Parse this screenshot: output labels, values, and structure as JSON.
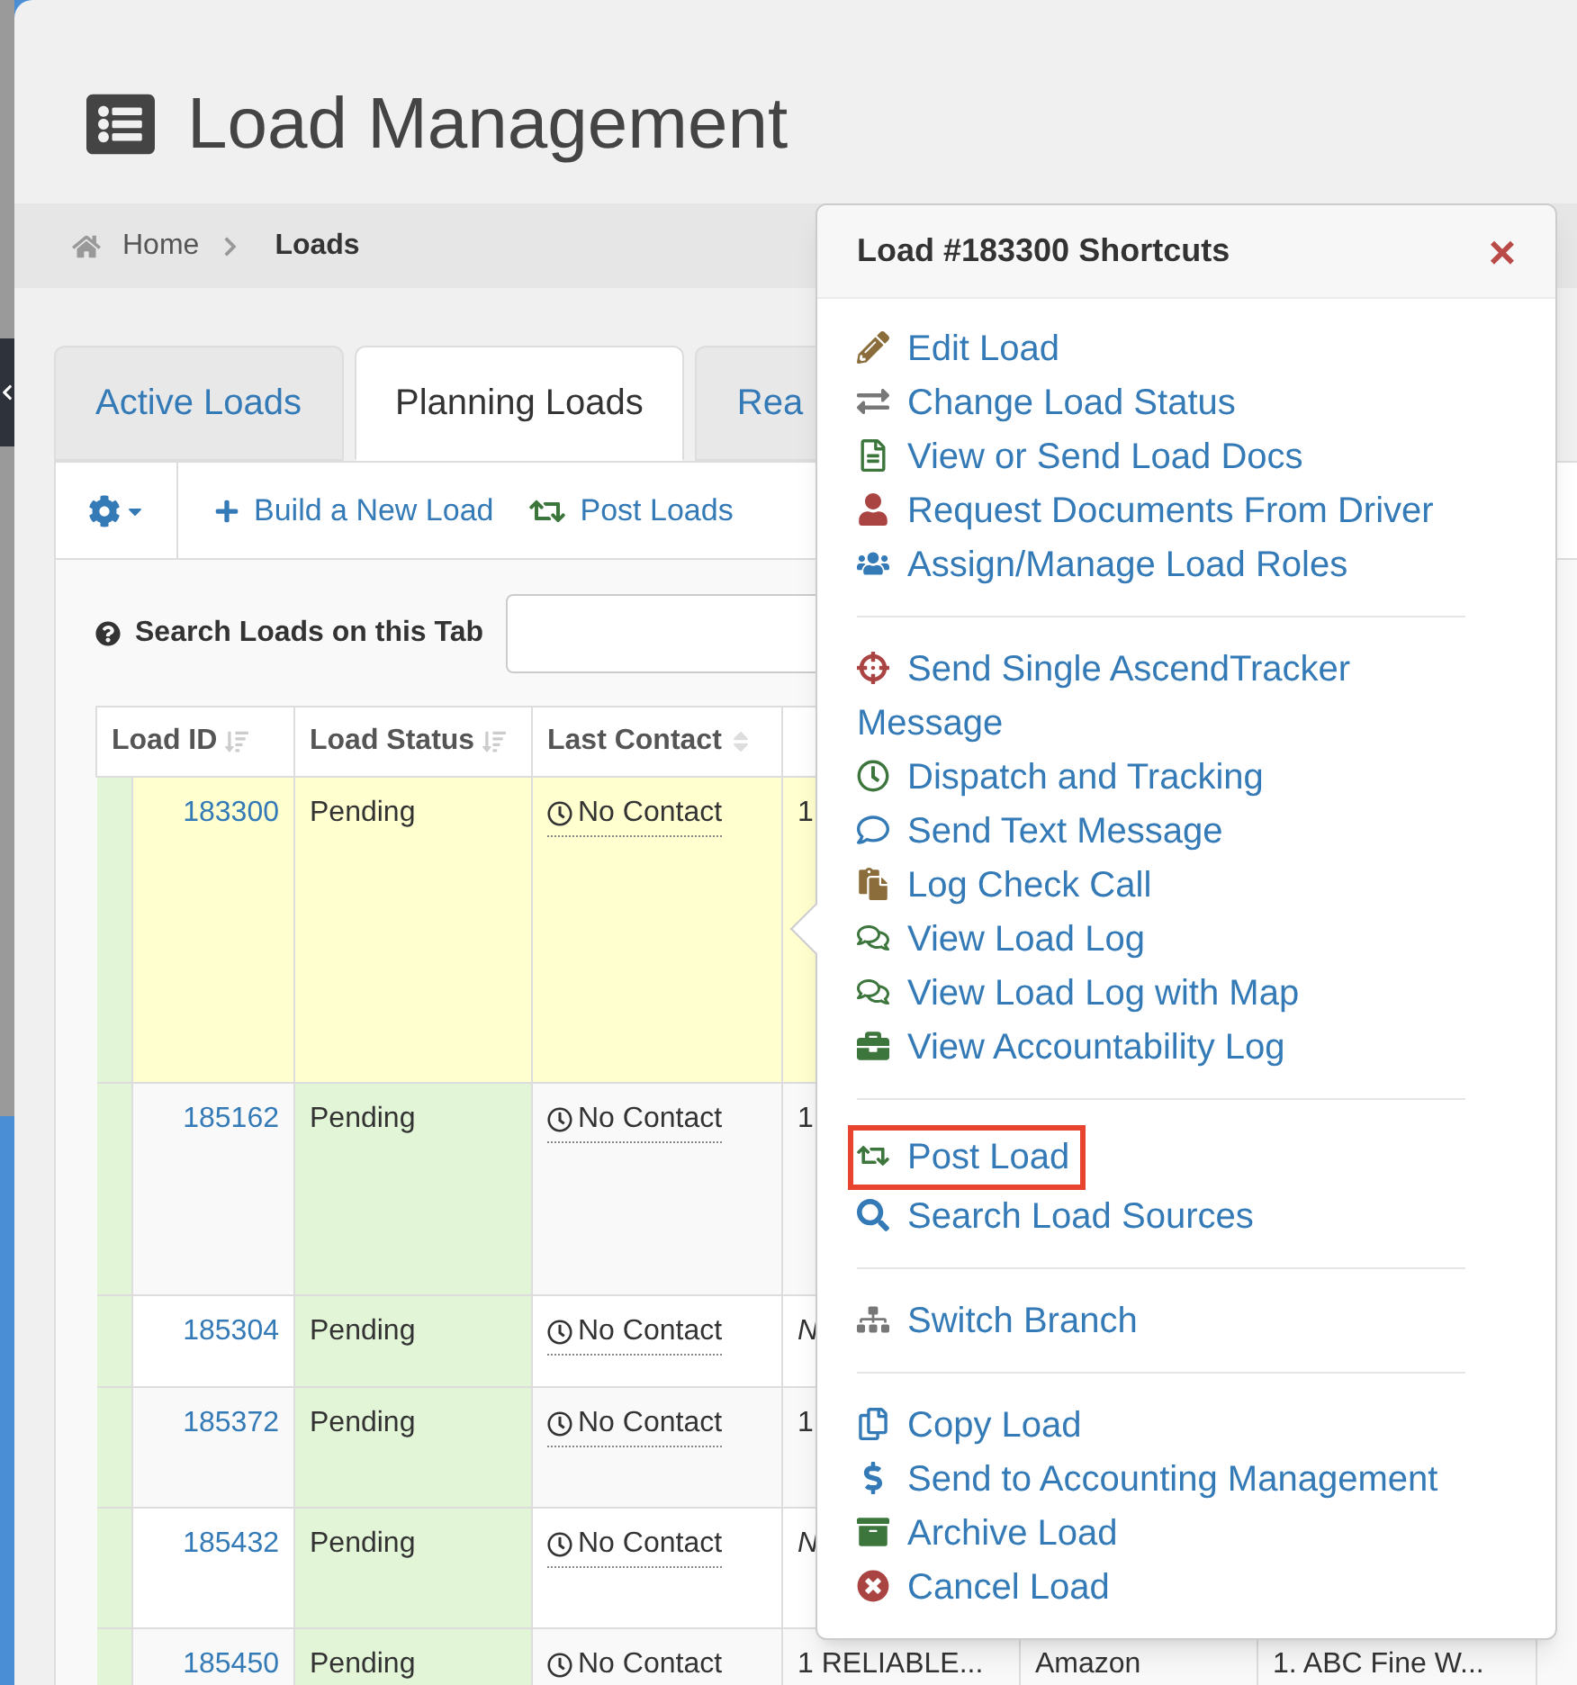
{
  "page_title": "Load Management",
  "breadcrumb": [
    {
      "label": "Home",
      "current": false
    },
    {
      "label": "Loads",
      "current": true
    }
  ],
  "tabs": [
    {
      "label": "Active Loads",
      "selected": false
    },
    {
      "label": "Planning Loads",
      "selected": true
    },
    {
      "label": "Rea",
      "selected": false
    }
  ],
  "toolbar": [
    {
      "label": "Build a New Load"
    },
    {
      "label": "Post Loads"
    }
  ],
  "search": {
    "label": "Search Loads on this Tab"
  },
  "table": {
    "columns": [
      "Load ID",
      "Load Status",
      "Last Contact"
    ],
    "rows": [
      {
        "load_id": "183300",
        "status": "Pending",
        "last_contact": "No Contact",
        "column_4": {
          "text": "1",
          "italic": false
        },
        "selected": true
      },
      {
        "load_id": "185162",
        "status": "Pending",
        "last_contact": "No Contact",
        "column_4": {
          "text": "1",
          "italic": false
        },
        "selected": false
      },
      {
        "load_id": "185304",
        "status": "Pending",
        "last_contact": "No Contact",
        "column_4": {
          "text": "N",
          "italic": true
        },
        "selected": false
      },
      {
        "load_id": "185372",
        "status": "Pending",
        "last_contact": "No Contact",
        "column_4": {
          "text": "1",
          "italic": false
        },
        "selected": false
      },
      {
        "load_id": "185432",
        "status": "Pending",
        "last_contact": "No Contact",
        "column_4": {
          "text": "N",
          "italic": true
        },
        "selected": false
      },
      {
        "load_id": "185450",
        "status": "Pending",
        "last_contact": "No Contact",
        "column_4": {
          "text": "1 RELIABLE...",
          "italic": false
        },
        "column_5": "Amazon",
        "column_6": "1. ABC Fine W...",
        "selected": false
      }
    ]
  },
  "popover": {
    "title": "Load #183300 Shortcuts",
    "close": "×",
    "sections": [
      [
        {
          "label": "Edit Load",
          "highlighted": false
        },
        {
          "label": "Change Load Status",
          "highlighted": false
        },
        {
          "label": "View or Send Load Docs",
          "highlighted": false
        },
        {
          "label": "Request Documents From Driver",
          "highlighted": false
        },
        {
          "label": "Assign/Manage Load Roles",
          "highlighted": false
        }
      ],
      [
        {
          "label": "Send Single AscendTracker Message",
          "highlighted": false
        },
        {
          "label": "Dispatch and Tracking",
          "highlighted": false
        },
        {
          "label": "Send Text Message",
          "highlighted": false
        },
        {
          "label": "Log Check Call",
          "highlighted": false
        },
        {
          "label": "View Load Log",
          "highlighted": false
        },
        {
          "label": "View Load Log with Map",
          "highlighted": false
        },
        {
          "label": "View Accountability Log",
          "highlighted": false
        }
      ],
      [
        {
          "label": "Post Load",
          "highlighted": true
        },
        {
          "label": "Search Load Sources",
          "highlighted": false
        }
      ],
      [
        {
          "label": "Switch Branch",
          "highlighted": false
        }
      ],
      [
        {
          "label": "Copy Load",
          "highlighted": false
        },
        {
          "label": "Send to Accounting Management",
          "highlighted": false
        },
        {
          "label": "Archive Load",
          "highlighted": false
        },
        {
          "label": "Cancel Load",
          "highlighted": false
        }
      ]
    ]
  }
}
